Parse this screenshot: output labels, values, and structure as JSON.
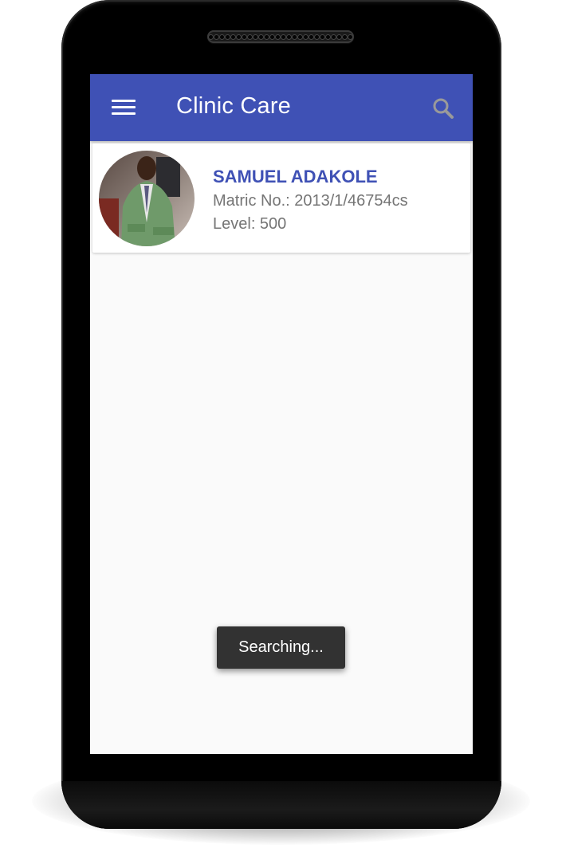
{
  "app_bar": {
    "title": "Clinic Care",
    "menu_icon": "menu-icon",
    "search_icon": "search-icon",
    "color": "#3f51b5"
  },
  "student_card": {
    "name": "SAMUEL ADAKOLE",
    "matric": "Matric No.: 2013/1/46754cs",
    "level": "Level: 500",
    "avatar_icon": "avatar-photo"
  },
  "toast": {
    "message": "Searching..."
  }
}
